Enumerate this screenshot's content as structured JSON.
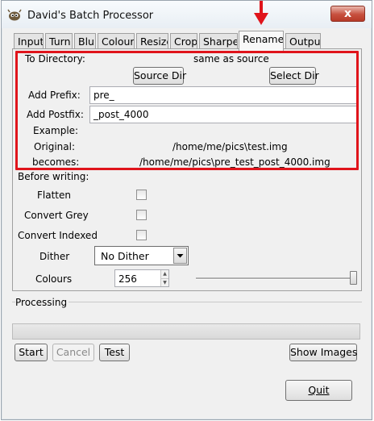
{
  "window": {
    "title": "David's Batch Processor",
    "close_glyph": "x"
  },
  "tabs": [
    {
      "label": "Input"
    },
    {
      "label": "Turn"
    },
    {
      "label": "Blur"
    },
    {
      "label": "Colour"
    },
    {
      "label": "Resize"
    },
    {
      "label": "Crop"
    },
    {
      "label": "Sharpen"
    },
    {
      "label": "Rename",
      "active": true
    },
    {
      "label": "Output"
    }
  ],
  "rename": {
    "to_directory_label": "To Directory:",
    "to_directory_value": "same as source",
    "source_dir_button": "Source Dir",
    "select_dir_button": "Select Dir",
    "add_prefix_label": "Add Prefix:",
    "add_prefix_value": "pre_",
    "add_postfix_label": "Add Postfix:",
    "add_postfix_value": "_post_4000",
    "example_label": "Example:",
    "original_label": "Original:",
    "original_value": "/home/me/pics\\test.img",
    "becomes_label": "becomes:",
    "becomes_value": "/home/me/pics\\pre_test_post_4000.img"
  },
  "before_writing": {
    "heading": "Before writing:",
    "flatten_label": "Flatten",
    "convert_grey_label": "Convert Grey",
    "convert_indexed_label": "Convert Indexed",
    "dither_label": "Dither",
    "dither_value": "No Dither",
    "colours_label": "Colours",
    "colours_value": "256",
    "colours_slider_level": 1.0
  },
  "processing": {
    "label": "Processing",
    "progress": 0
  },
  "actions": {
    "start": "Start",
    "cancel": "Cancel",
    "test": "Test",
    "show_images": "Show Images",
    "quit": "Quit"
  },
  "colors": {
    "highlight": "#e0141b",
    "annotation_arrow": "#e0141b"
  },
  "icons": {
    "app": "gimp-icon",
    "annotation": "red-arrow-down-icon"
  }
}
